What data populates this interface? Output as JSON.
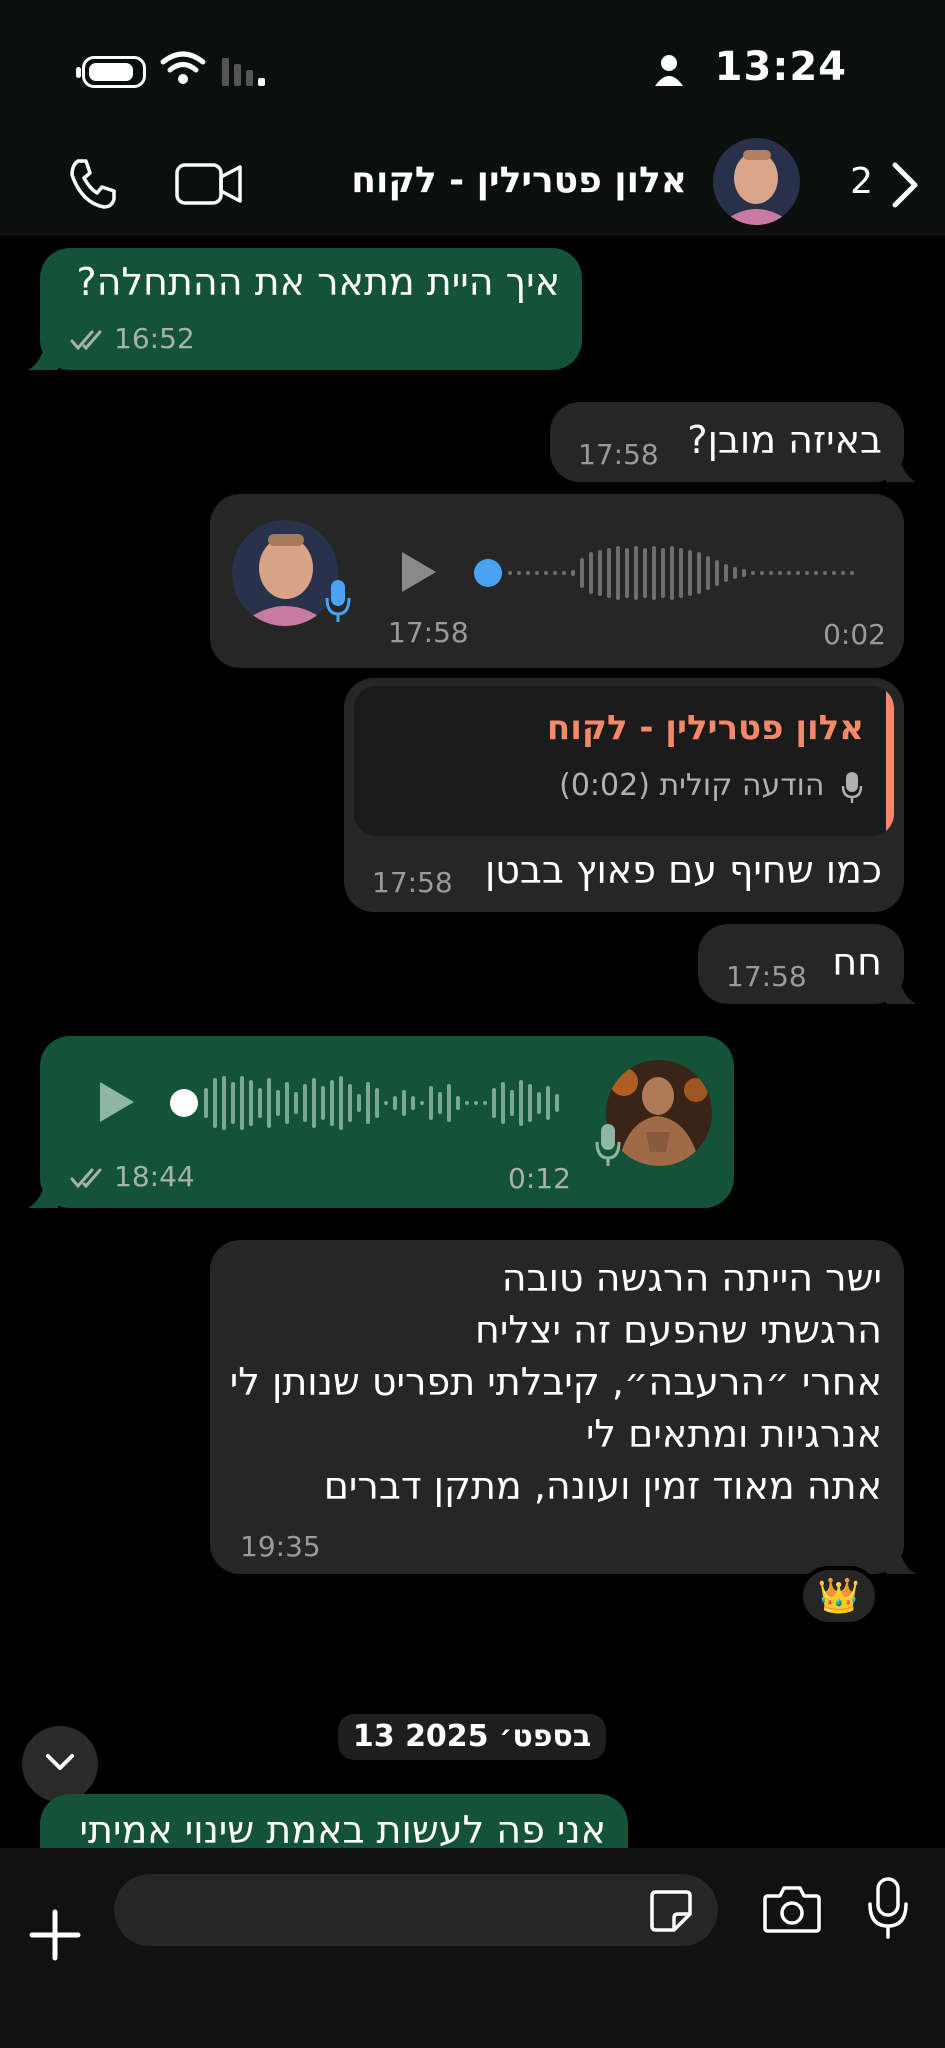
{
  "status_bar": {
    "time": "13:24"
  },
  "header": {
    "contact_name": "אלון פטרילין - לקוח",
    "back_count": "2"
  },
  "messages": {
    "m1": {
      "text": "איך היית מתאר את ההתחלה?",
      "time": "16:52"
    },
    "m2": {
      "text": "באיזה מובן?",
      "time": "17:58"
    },
    "m3": {
      "time": "17:58",
      "duration": "0:02"
    },
    "m4": {
      "quote_name": "אלון פטרילין - לקוח",
      "quote_sub": "הודעה קולית (0:02)",
      "text": "כמו שחיף עם פאוץ בבטן",
      "time": "17:58"
    },
    "m5": {
      "text": "חח",
      "time": "17:58"
    },
    "m6": {
      "time": "18:44",
      "duration": "0:12"
    },
    "m7": {
      "lines": [
        "ישר הייתה הרגשה טובה",
        "הרגשתי שהפעם זה יצליח",
        "אחרי ״הרעבה״, קיבלתי תפריט שנותן לי",
        "אנרגיות ומתאים לי",
        "אתה מאוד זמין ועונה, מתקן דברים"
      ],
      "time": "19:35",
      "reaction": "👑"
    },
    "date_separator": "13 בספט׳ 2025",
    "m8": {
      "text": "אני פה לעשות באמת שינוי אמיתי"
    }
  },
  "composer": {
    "placeholder": ""
  },
  "colors": {
    "outgoing": "#145239",
    "incoming": "#262626",
    "accent_blue": "#4aa3f0",
    "quote_accent": "#f5896a"
  },
  "icons": [
    "battery-icon",
    "wifi-icon",
    "cellular-icon",
    "person-icon",
    "phone-icon",
    "video-icon",
    "chevron-right-icon",
    "play-icon",
    "mic-icon",
    "double-check-icon",
    "chevron-down-icon",
    "plus-icon",
    "sticker-icon",
    "camera-icon"
  ]
}
